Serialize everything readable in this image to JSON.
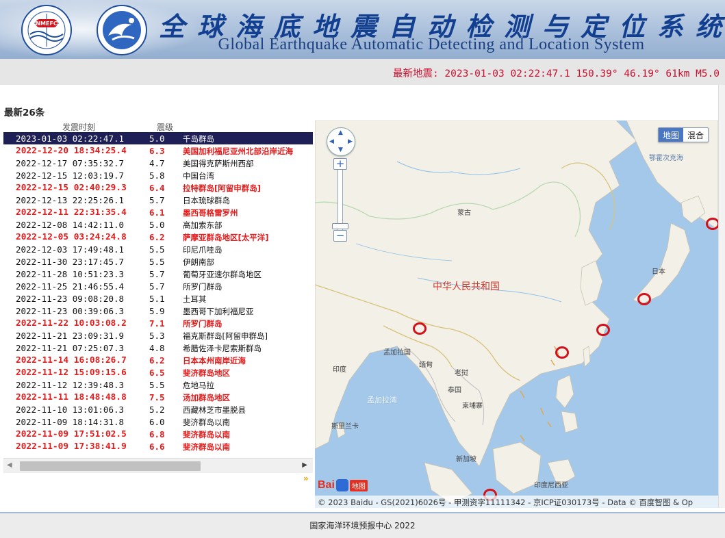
{
  "header": {
    "logo_left_text": "NMEFC",
    "title_cn": "全球海底地震自动检测与定位系统",
    "title_en": "Global Earthquake Automatic Detecting and Location System"
  },
  "latest": {
    "text": "最新地震: 2023-01-03 02:22:47.1 150.39° 46.19° 61km M5.0"
  },
  "list": {
    "title": "最新26条",
    "col_time": "发震时刻",
    "col_mag": "震级",
    "rows": [
      {
        "time": "2023-01-03 02:22:47.1",
        "mag": "5.0",
        "loc": "千岛群岛"
      },
      {
        "time": "2022-12-20 18:34:25.4",
        "mag": "6.3",
        "loc": "美国加利福尼亚州北部沿岸近海"
      },
      {
        "time": "2022-12-17 07:35:32.7",
        "mag": "4.7",
        "loc": "美国得克萨斯州西部"
      },
      {
        "time": "2022-12-15 12:03:19.7",
        "mag": "5.8",
        "loc": "中国台湾"
      },
      {
        "time": "2022-12-15 02:40:29.3",
        "mag": "6.4",
        "loc": "拉特群岛[阿留申群岛]"
      },
      {
        "time": "2022-12-13 22:25:26.1",
        "mag": "5.7",
        "loc": "日本琉球群岛"
      },
      {
        "time": "2022-12-11 22:31:35.4",
        "mag": "6.1",
        "loc": "墨西哥格雷罗州"
      },
      {
        "time": "2022-12-08 14:42:11.0",
        "mag": "5.0",
        "loc": "高加索东部"
      },
      {
        "time": "2022-12-05 03:24:24.8",
        "mag": "6.2",
        "loc": "萨摩亚群岛地区[太平洋]"
      },
      {
        "time": "2022-12-03 17:49:48.1",
        "mag": "5.5",
        "loc": "印尼爪哇岛"
      },
      {
        "time": "2022-11-30 23:17:45.7",
        "mag": "5.5",
        "loc": "伊朗南部"
      },
      {
        "time": "2022-11-28 10:51:23.3",
        "mag": "5.7",
        "loc": "葡萄牙亚速尔群岛地区"
      },
      {
        "time": "2022-11-25 21:46:55.4",
        "mag": "5.7",
        "loc": "所罗门群岛"
      },
      {
        "time": "2022-11-23 09:08:20.8",
        "mag": "5.1",
        "loc": "土耳其"
      },
      {
        "time": "2022-11-23 00:39:06.3",
        "mag": "5.9",
        "loc": "墨西哥下加利福尼亚"
      },
      {
        "time": "2022-11-22 10:03:08.2",
        "mag": "7.1",
        "loc": "所罗门群岛"
      },
      {
        "time": "2022-11-21 23:09:31.9",
        "mag": "5.3",
        "loc": "福克斯群岛[阿留申群岛]"
      },
      {
        "time": "2022-11-21 07:25:07.3",
        "mag": "4.8",
        "loc": "希腊佐泽卡尼索斯群岛"
      },
      {
        "time": "2022-11-14 16:08:26.7",
        "mag": "6.2",
        "loc": "日本本州南岸近海"
      },
      {
        "time": "2022-11-12 15:09:15.6",
        "mag": "6.5",
        "loc": "斐济群岛地区"
      },
      {
        "time": "2022-11-12 12:39:48.3",
        "mag": "5.5",
        "loc": "危地马拉"
      },
      {
        "time": "2022-11-11 18:48:48.8",
        "mag": "7.5",
        "loc": "汤加群岛地区"
      },
      {
        "time": "2022-11-10 13:01:06.3",
        "mag": "5.2",
        "loc": "西藏林芝市墨脱县"
      },
      {
        "time": "2022-11-09 18:14:31.8",
        "mag": "6.0",
        "loc": "斐济群岛以南"
      },
      {
        "time": "2022-11-09 17:51:02.5",
        "mag": "6.8",
        "loc": "斐济群岛以南"
      },
      {
        "time": "2022-11-09 17:38:41.9",
        "mag": "6.6",
        "loc": "斐济群岛以南"
      }
    ]
  },
  "map": {
    "type_map": "地图",
    "type_hybrid": "混合",
    "labels": {
      "okhotsk": "鄂霍次克海",
      "mongolia": "蒙古",
      "china": "中华人民共和国",
      "japan": "日本",
      "bangladesh": "孟加拉国",
      "myanmar": "缅甸",
      "india": "印度",
      "laos": "老挝",
      "thailand": "泰国",
      "bay_of_bengal": "孟加拉湾",
      "cambodia": "柬埔寨",
      "sri_lanka": "斯里兰卡",
      "singapore": "新加坡",
      "indonesia": "印度尼西亚"
    },
    "logo_bai": "Bai",
    "logo_ditu": "地图",
    "copyright": "© 2023 Baidu - GS(2021)6026号 - 甲测资字11111342 - 京ICP证030173号 - Data © 百度智图 & Op"
  },
  "footer": {
    "text": "国家海洋环境预报中心 2022"
  },
  "colors": {
    "alert_red": "#e31b1b",
    "selected_row": "#1e1f57",
    "title_blue": "#123f8f"
  }
}
